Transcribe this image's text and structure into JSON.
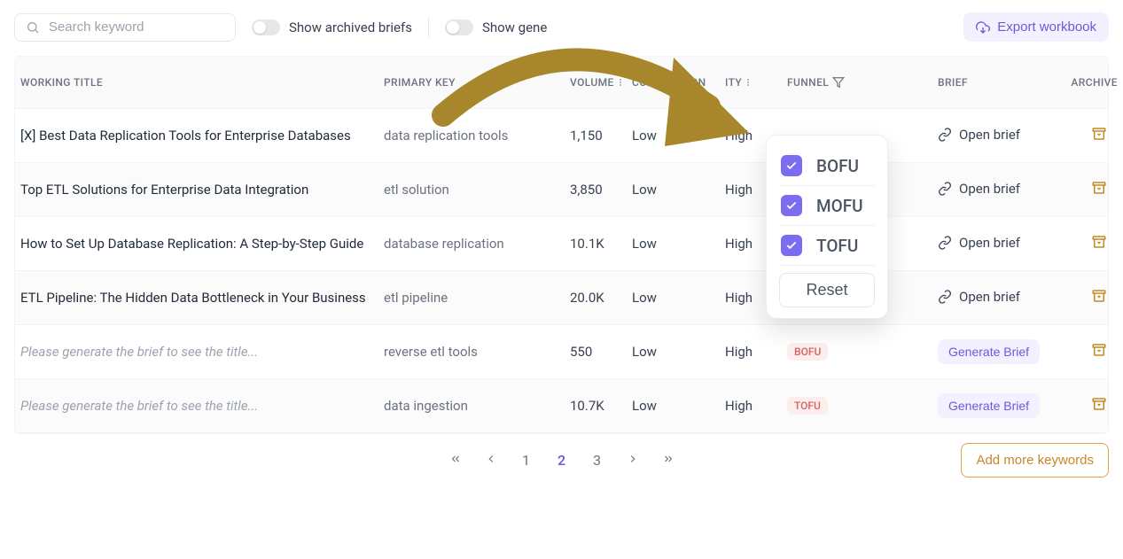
{
  "search": {
    "placeholder": "Search keyword"
  },
  "toggles": {
    "archived_label": "Show archived briefs",
    "generated_label": "Show gene"
  },
  "export_label": "Export workbook",
  "columns": {
    "working_title": "WORKING TITLE",
    "primary_keyword": "PRIMARY KEY",
    "volume": "VOLUME",
    "competition": "COMPETITION",
    "priority": "ITY",
    "funnel": "FUNNEL",
    "brief": "BRIEF",
    "archive": "ARCHIVE"
  },
  "funnel_filter": {
    "options": [
      "BOFU",
      "MOFU",
      "TOFU"
    ],
    "reset_label": "Reset"
  },
  "rows": [
    {
      "title": "[X] Best Data Replication Tools for Enterprise Databases",
      "placeholder": false,
      "keyword": "data replication tools",
      "volume": "1,150",
      "competition": "Low",
      "priority": "High",
      "funnel_badge": "",
      "brief_action": "Open brief",
      "brief_type": "open"
    },
    {
      "title": "Top ETL Solutions for Enterprise Data Integration",
      "placeholder": false,
      "keyword": "etl solution",
      "volume": "3,850",
      "competition": "Low",
      "priority": "High",
      "funnel_badge": "",
      "brief_action": "Open brief",
      "brief_type": "open"
    },
    {
      "title": "How to Set Up Database Replication: A Step-by-Step Guide",
      "placeholder": false,
      "keyword": "database replication",
      "volume": "10.1K",
      "competition": "Low",
      "priority": "High",
      "funnel_badge": "",
      "brief_action": "Open brief",
      "brief_type": "open"
    },
    {
      "title": "ETL Pipeline: The Hidden Data Bottleneck in Your Business",
      "placeholder": false,
      "keyword": "etl pipeline",
      "volume": "20.0K",
      "competition": "Low",
      "priority": "High",
      "funnel_badge": "",
      "brief_action": "Open brief",
      "brief_type": "open"
    },
    {
      "title": "Please generate the brief to see the title...",
      "placeholder": true,
      "keyword": "reverse etl tools",
      "volume": "550",
      "competition": "Low",
      "priority": "High",
      "funnel_badge": "BOFU",
      "brief_action": "Generate Brief",
      "brief_type": "generate"
    },
    {
      "title": "Please generate the brief to see the title...",
      "placeholder": true,
      "keyword": "data ingestion",
      "volume": "10.7K",
      "competition": "Low",
      "priority": "High",
      "funnel_badge": "TOFU",
      "brief_action": "Generate Brief",
      "brief_type": "generate"
    }
  ],
  "pagination": {
    "pages": [
      "1",
      "2",
      "3"
    ],
    "active_index": 1
  },
  "add_keywords_label": "Add more keywords"
}
